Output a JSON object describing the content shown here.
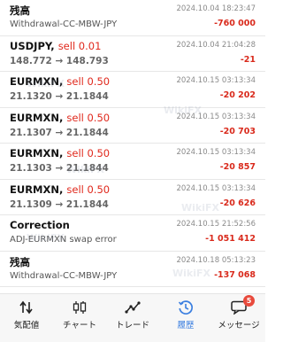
{
  "rows": [
    {
      "type": "balance",
      "title": "残高",
      "sub": "Withdrawal-CC-MBW-JPY",
      "time": "2024.10.04 18:23:47",
      "amount": "-760 000"
    },
    {
      "type": "trade",
      "symbol": "USDJPY,",
      "side": "sell 0.01",
      "price": "148.772 → 148.793",
      "time": "2024.10.04 21:04:28",
      "amount": "-21"
    },
    {
      "type": "trade",
      "symbol": "EURMXN,",
      "side": "sell 0.50",
      "price": "21.1320 → 21.1844",
      "time": "2024.10.15 03:13:34",
      "amount": "-20 202"
    },
    {
      "type": "trade",
      "symbol": "EURMXN,",
      "side": "sell 0.50",
      "price": "21.1307 → 21.1844",
      "time": "2024.10.15 03:13:34",
      "amount": "-20 703"
    },
    {
      "type": "trade",
      "symbol": "EURMXN,",
      "side": "sell 0.50",
      "price": "21.1303 → 21.1844",
      "time": "2024.10.15 03:13:34",
      "amount": "-20 857"
    },
    {
      "type": "trade",
      "symbol": "EURMXN,",
      "side": "sell 0.50",
      "price": "21.1309 → 21.1844",
      "time": "2024.10.15 03:13:34",
      "amount": "-20 626"
    },
    {
      "type": "balance",
      "title": "Correction",
      "sub": "ADJ-EURMXN swap error",
      "time": "2024.10.15 21:52:56",
      "amount": "-1 051 412"
    },
    {
      "type": "balance",
      "title": "残高",
      "sub": "Withdrawal-CC-MBW-JPY",
      "time": "2024.10.18 05:13:23",
      "amount": "-137 068"
    }
  ],
  "tabs": [
    {
      "label": "気配値",
      "icon": "quotes-arrows-icon",
      "active": false
    },
    {
      "label": "チャート",
      "icon": "candlestick-chart-icon",
      "active": false
    },
    {
      "label": "トレード",
      "icon": "trade-line-icon",
      "active": false
    },
    {
      "label": "履歴",
      "icon": "history-clock-icon",
      "active": true
    },
    {
      "label": "メッセージ",
      "icon": "message-bubble-icon",
      "active": false,
      "badge": "5"
    }
  ],
  "watermark_text": "WikiFX",
  "colors": {
    "loss": "#d92a1c",
    "sell": "#e0281c",
    "active_tab": "#3b7fe0",
    "badge": "#e84a3c"
  }
}
